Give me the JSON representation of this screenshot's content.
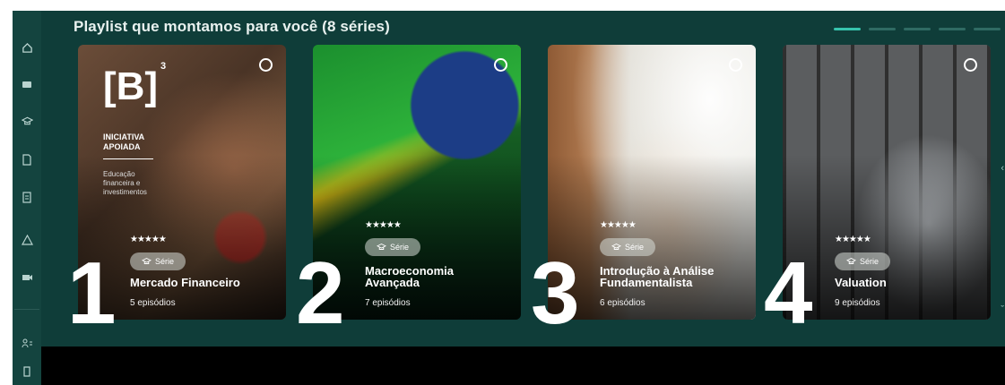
{
  "header": {
    "title": "Playlist que montamos para você (8 séries)"
  },
  "pagination": {
    "total": 5,
    "active": 0
  },
  "sidebar": {
    "icons": [
      "home-icon",
      "chat-icon",
      "graduation-cap-icon",
      "file-edit-icon",
      "document-icon",
      "alert-triangle-icon",
      "video-camera-icon",
      "users-icon",
      "door-exit-icon"
    ]
  },
  "cards": [
    {
      "rank": "1",
      "title": "Mercado Financeiro",
      "episodes": "5 episódios",
      "rating": "★★★★★",
      "badge": "Série",
      "brand": "[B]",
      "brand_sup": "3",
      "brand_tag": "INICIATIVA\nAPOIADA",
      "brand_sub": "Educação\nfinanceira e\ninvestimentos"
    },
    {
      "rank": "2",
      "title": "Macroeconomia\nAvançada",
      "episodes": "7 episódios",
      "rating": "★★★★★",
      "badge": "Série"
    },
    {
      "rank": "3",
      "title": "Introdução à Análise\nFundamentalista",
      "episodes": "6 episódios",
      "rating": "★★★★★",
      "badge": "Série"
    },
    {
      "rank": "4",
      "title": "Valuation",
      "episodes": "9 episódios",
      "rating": "★★★★★",
      "badge": "Série"
    }
  ],
  "colors": {
    "background": "#0f3d39",
    "sidebar": "#14443f",
    "accent": "#37c3ad"
  }
}
